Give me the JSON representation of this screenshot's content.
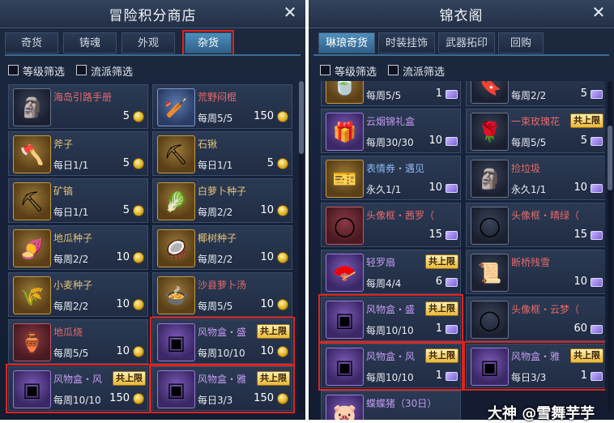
{
  "colors": {
    "highlight": "#e0241f",
    "accent_tab": "#4e8fbc",
    "panel_bg": "#17223a",
    "coin": "#e0b52a",
    "ticket": "#9a86e8"
  },
  "left": {
    "title": "冒险积分商店",
    "close_icon": "✕",
    "tabs": [
      {
        "label": "奇货"
      },
      {
        "label": "铸魂"
      },
      {
        "label": "外观"
      },
      {
        "label": "杂货"
      }
    ],
    "filters": [
      {
        "label": "等级筛选"
      },
      {
        "label": "流派筛选"
      }
    ],
    "items": [
      {
        "name": "海岛引路手册",
        "limit": "",
        "price": "5",
        "icon": "statue-icon",
        "glyph": "🗿"
      },
      {
        "name": "荒野闷棍",
        "limit": "每周5/5",
        "price": "150",
        "icon": "club-icon",
        "glyph": "🏏"
      },
      {
        "name": "斧子",
        "limit": "每日1/1",
        "price": "5",
        "icon": "axe-icon",
        "glyph": "🪓"
      },
      {
        "name": "石锹",
        "limit": "每日1/1",
        "price": "5",
        "icon": "shovel-icon",
        "glyph": "⛏"
      },
      {
        "name": "矿镐",
        "limit": "每日1/1",
        "price": "5",
        "icon": "pickaxe-icon",
        "glyph": "⛏"
      },
      {
        "name": "白萝卜种子",
        "limit": "每周2/2",
        "price": "10",
        "icon": "radish-icon",
        "glyph": "🥬"
      },
      {
        "name": "地瓜种子",
        "limit": "每周2/2",
        "price": "10",
        "icon": "sweet-potato-icon",
        "glyph": "🍠"
      },
      {
        "name": "椰树种子",
        "limit": "每周2/2",
        "price": "10",
        "icon": "coconut-icon",
        "glyph": "🥥"
      },
      {
        "name": "小麦种子",
        "limit": "每周2/2",
        "price": "10",
        "icon": "wheat-sack-icon",
        "glyph": "🌾"
      },
      {
        "name": "沙县萝卜汤",
        "limit": "每周5/5",
        "price": "10",
        "icon": "soup-icon",
        "glyph": "🍲"
      },
      {
        "name": "地瓜烧",
        "limit": "每周5/5",
        "price": "10",
        "icon": "wine-jar-icon",
        "glyph": "🏺"
      },
      {
        "name": "风物盒・盛",
        "limit": "每周10/10",
        "price": "10",
        "badge": "共上限",
        "icon": "box-icon",
        "glyph": "▣"
      },
      {
        "name": "风物盒・风",
        "limit": "每周10/10",
        "price": "150",
        "badge": "共上限",
        "icon": "box-icon",
        "glyph": "▣"
      },
      {
        "name": "风物盒・雅",
        "limit": "每日3/3",
        "price": "150",
        "badge": "共上限",
        "icon": "box-icon",
        "glyph": "▣"
      }
    ]
  },
  "right": {
    "title": "锦衣阁",
    "close_icon": "✕",
    "tabs": [
      {
        "label": "琳琅奇货"
      },
      {
        "label": "时装挂饰"
      },
      {
        "label": "武器拓印"
      },
      {
        "label": "回购"
      }
    ],
    "filters": [
      {
        "label": "等级筛选"
      },
      {
        "label": "流派筛选"
      }
    ],
    "items": [
      {
        "name": "",
        "limit": "每周5/5",
        "price": "1",
        "icon": "jade-icon",
        "glyph": "🍵"
      },
      {
        "name": "",
        "limit": "每周2/2",
        "price": "5",
        "icon": "charm-icon",
        "glyph": "🔖"
      },
      {
        "name": "云烟锦礼盒",
        "limit": "每周30/30",
        "price": "10",
        "icon": "gift-box-icon",
        "glyph": "🎁"
      },
      {
        "name": "一束玫瑰花",
        "limit": "每周5/5",
        "price": "5",
        "badge": "共上限",
        "icon": "rose-icon",
        "glyph": "🌹"
      },
      {
        "name": "表情券・遇见",
        "limit": "永久1/1",
        "price": "10",
        "icon": "ticket-icon",
        "glyph": "🎫"
      },
      {
        "name": "捡垃圾",
        "limit": "永久1/1",
        "price": "10",
        "icon": "statue-icon",
        "glyph": "🗿"
      },
      {
        "name": "头像框・茜罗（30...",
        "limit": "",
        "price": "15",
        "icon": "frame-icon",
        "glyph": "◯"
      },
      {
        "name": "头像框・晴绿（30...",
        "limit": "",
        "price": "15",
        "icon": "frame-icon",
        "glyph": "◯"
      },
      {
        "name": "轻罗扇",
        "limit": "每周4/4",
        "price": "6",
        "badge": "共上限",
        "icon": "fan-icon",
        "glyph": "🪭"
      },
      {
        "name": "断桥残雪",
        "limit": "",
        "price": "10",
        "icon": "scroll-icon",
        "glyph": "📜"
      },
      {
        "name": "风物盒・盛",
        "limit": "每周10/10",
        "price": "1",
        "badge": "共上限",
        "icon": "box-icon",
        "glyph": "▣"
      },
      {
        "name": "头像框・云梦（30...",
        "limit": "",
        "price": "60",
        "icon": "frame-icon",
        "glyph": "◯"
      },
      {
        "name": "风物盒・风",
        "limit": "每周10/10",
        "price": "1",
        "badge": "共上限",
        "icon": "box-icon",
        "glyph": "▣"
      },
      {
        "name": "风物盒・雅",
        "limit": "每日3/3",
        "price": "1",
        "badge": "共上限",
        "icon": "box-icon",
        "glyph": "▣"
      },
      {
        "name": "蝶蝶猪（30日）",
        "limit": "",
        "price": "",
        "icon": "pig-icon",
        "glyph": "🐷"
      }
    ]
  },
  "watermark": "大神 @雪舞芋芋"
}
